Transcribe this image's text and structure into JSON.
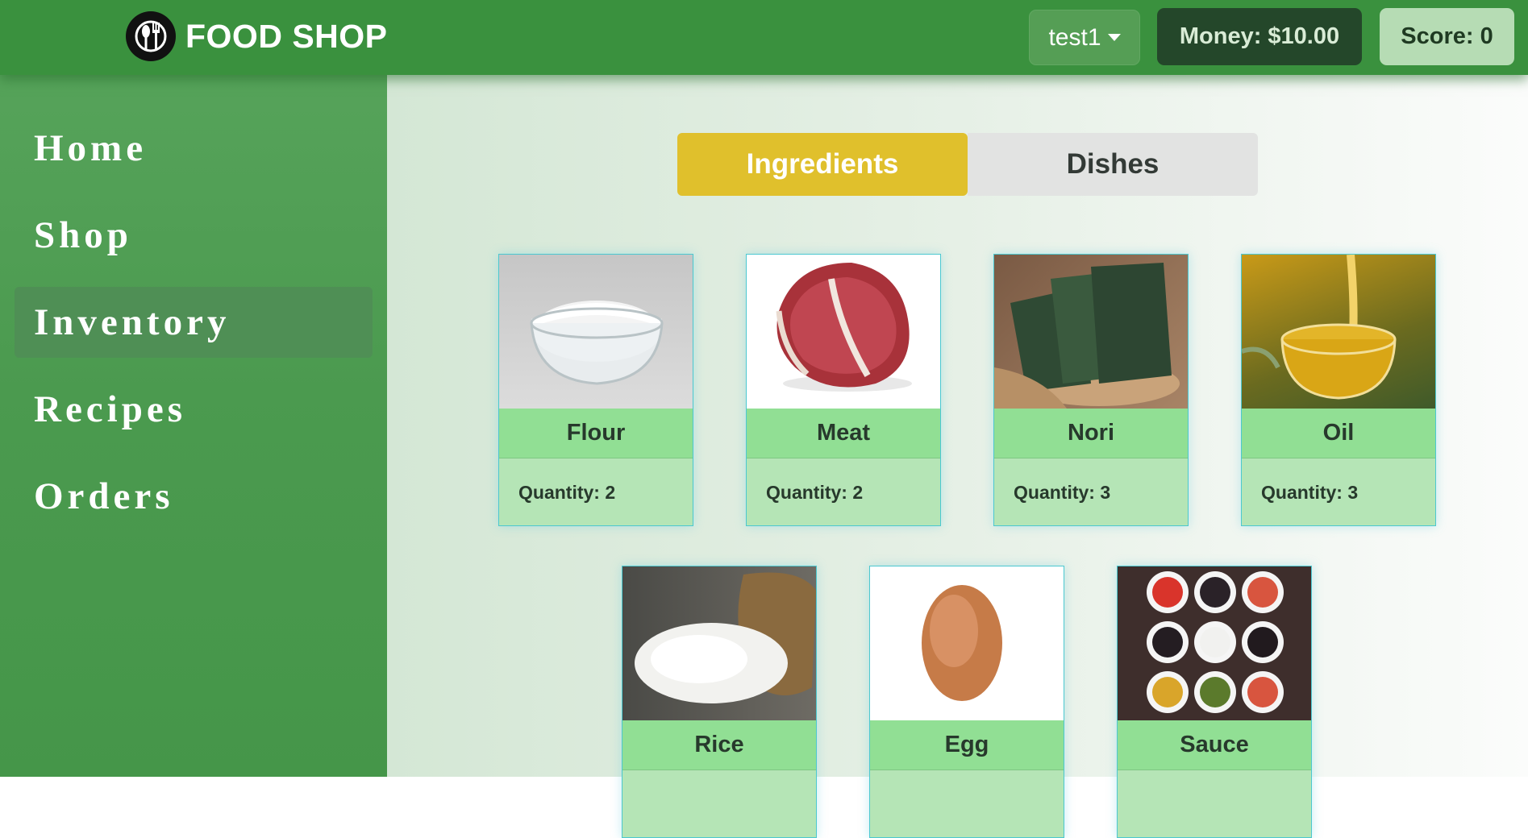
{
  "brand": {
    "name": "FOOD SHOP",
    "logo_icon": "fork-spoon-icon"
  },
  "header": {
    "user_label": "test1",
    "money_label": "Money: $10.00",
    "score_label": "Score: 0"
  },
  "sidebar": {
    "items": [
      {
        "label": "Home",
        "active": false
      },
      {
        "label": "Shop",
        "active": false
      },
      {
        "label": "Inventory",
        "active": true
      },
      {
        "label": "Recipes",
        "active": false
      },
      {
        "label": "Orders",
        "active": false
      }
    ]
  },
  "tabs": [
    {
      "label": "Ingredients",
      "active": true
    },
    {
      "label": "Dishes",
      "active": false
    }
  ],
  "items": [
    {
      "name": "Flour",
      "quantity": "Quantity: 2"
    },
    {
      "name": "Meat",
      "quantity": "Quantity: 2"
    },
    {
      "name": "Nori",
      "quantity": "Quantity: 3"
    },
    {
      "name": "Oil",
      "quantity": "Quantity: 3"
    },
    {
      "name": "Rice",
      "quantity": ""
    },
    {
      "name": "Egg",
      "quantity": ""
    },
    {
      "name": "Sauce",
      "quantity": ""
    }
  ],
  "colors": {
    "topbar": "#3a913e",
    "sidebar": "#4b9a4f",
    "active_tab": "#e0c02c",
    "card_name_bg": "#91df94",
    "card_body_bg": "#b5e5b6"
  }
}
